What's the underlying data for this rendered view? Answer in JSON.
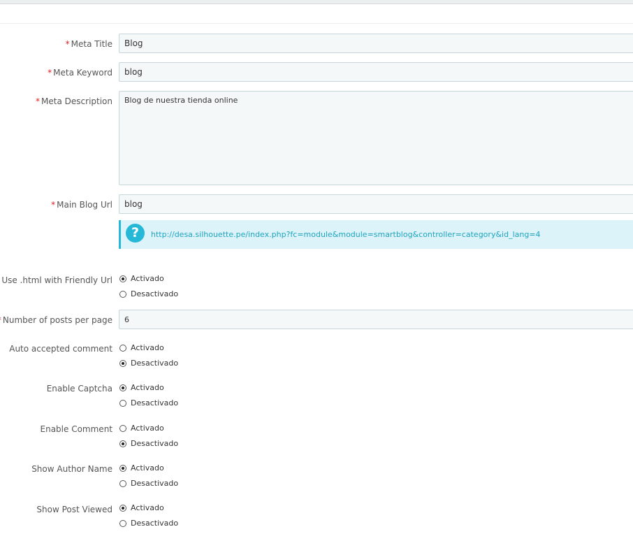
{
  "fields": {
    "meta_title": {
      "label": "Meta Title",
      "value": "Blog"
    },
    "meta_keyword": {
      "label": "Meta Keyword",
      "value": "blog"
    },
    "meta_description": {
      "label": "Meta Description",
      "value": "Blog de nuestra tienda online"
    },
    "main_blog_url": {
      "label": "Main Blog Url",
      "value": "blog"
    },
    "help_url": "http://desa.silhouette.pe/index.php?fc=module&module=smartblog&controller=category&id_lang=4",
    "posts_per_page": {
      "label": "Number of posts per page",
      "value": "6"
    }
  },
  "required_mark": "*",
  "help_icon_glyph": "?",
  "options": {
    "on": "Activado",
    "off": "Desactivado"
  },
  "toggles": {
    "html_friendly": {
      "label": "Use .html with Friendly Url",
      "selected": "on"
    },
    "auto_accept": {
      "label": "Auto accepted comment",
      "selected": "off"
    },
    "captcha": {
      "label": "Enable Captcha",
      "selected": "on"
    },
    "comment": {
      "label": "Enable Comment",
      "selected": "off"
    },
    "author_name": {
      "label": "Show Author Name",
      "selected": "on"
    },
    "post_viewed": {
      "label": "Show Post Viewed",
      "selected": "on"
    }
  },
  "colors": {
    "required": "#e11d1d",
    "info_accent": "#25b9d7",
    "info_bg": "#dcf4f9",
    "input_bg": "#f5f8f9"
  }
}
